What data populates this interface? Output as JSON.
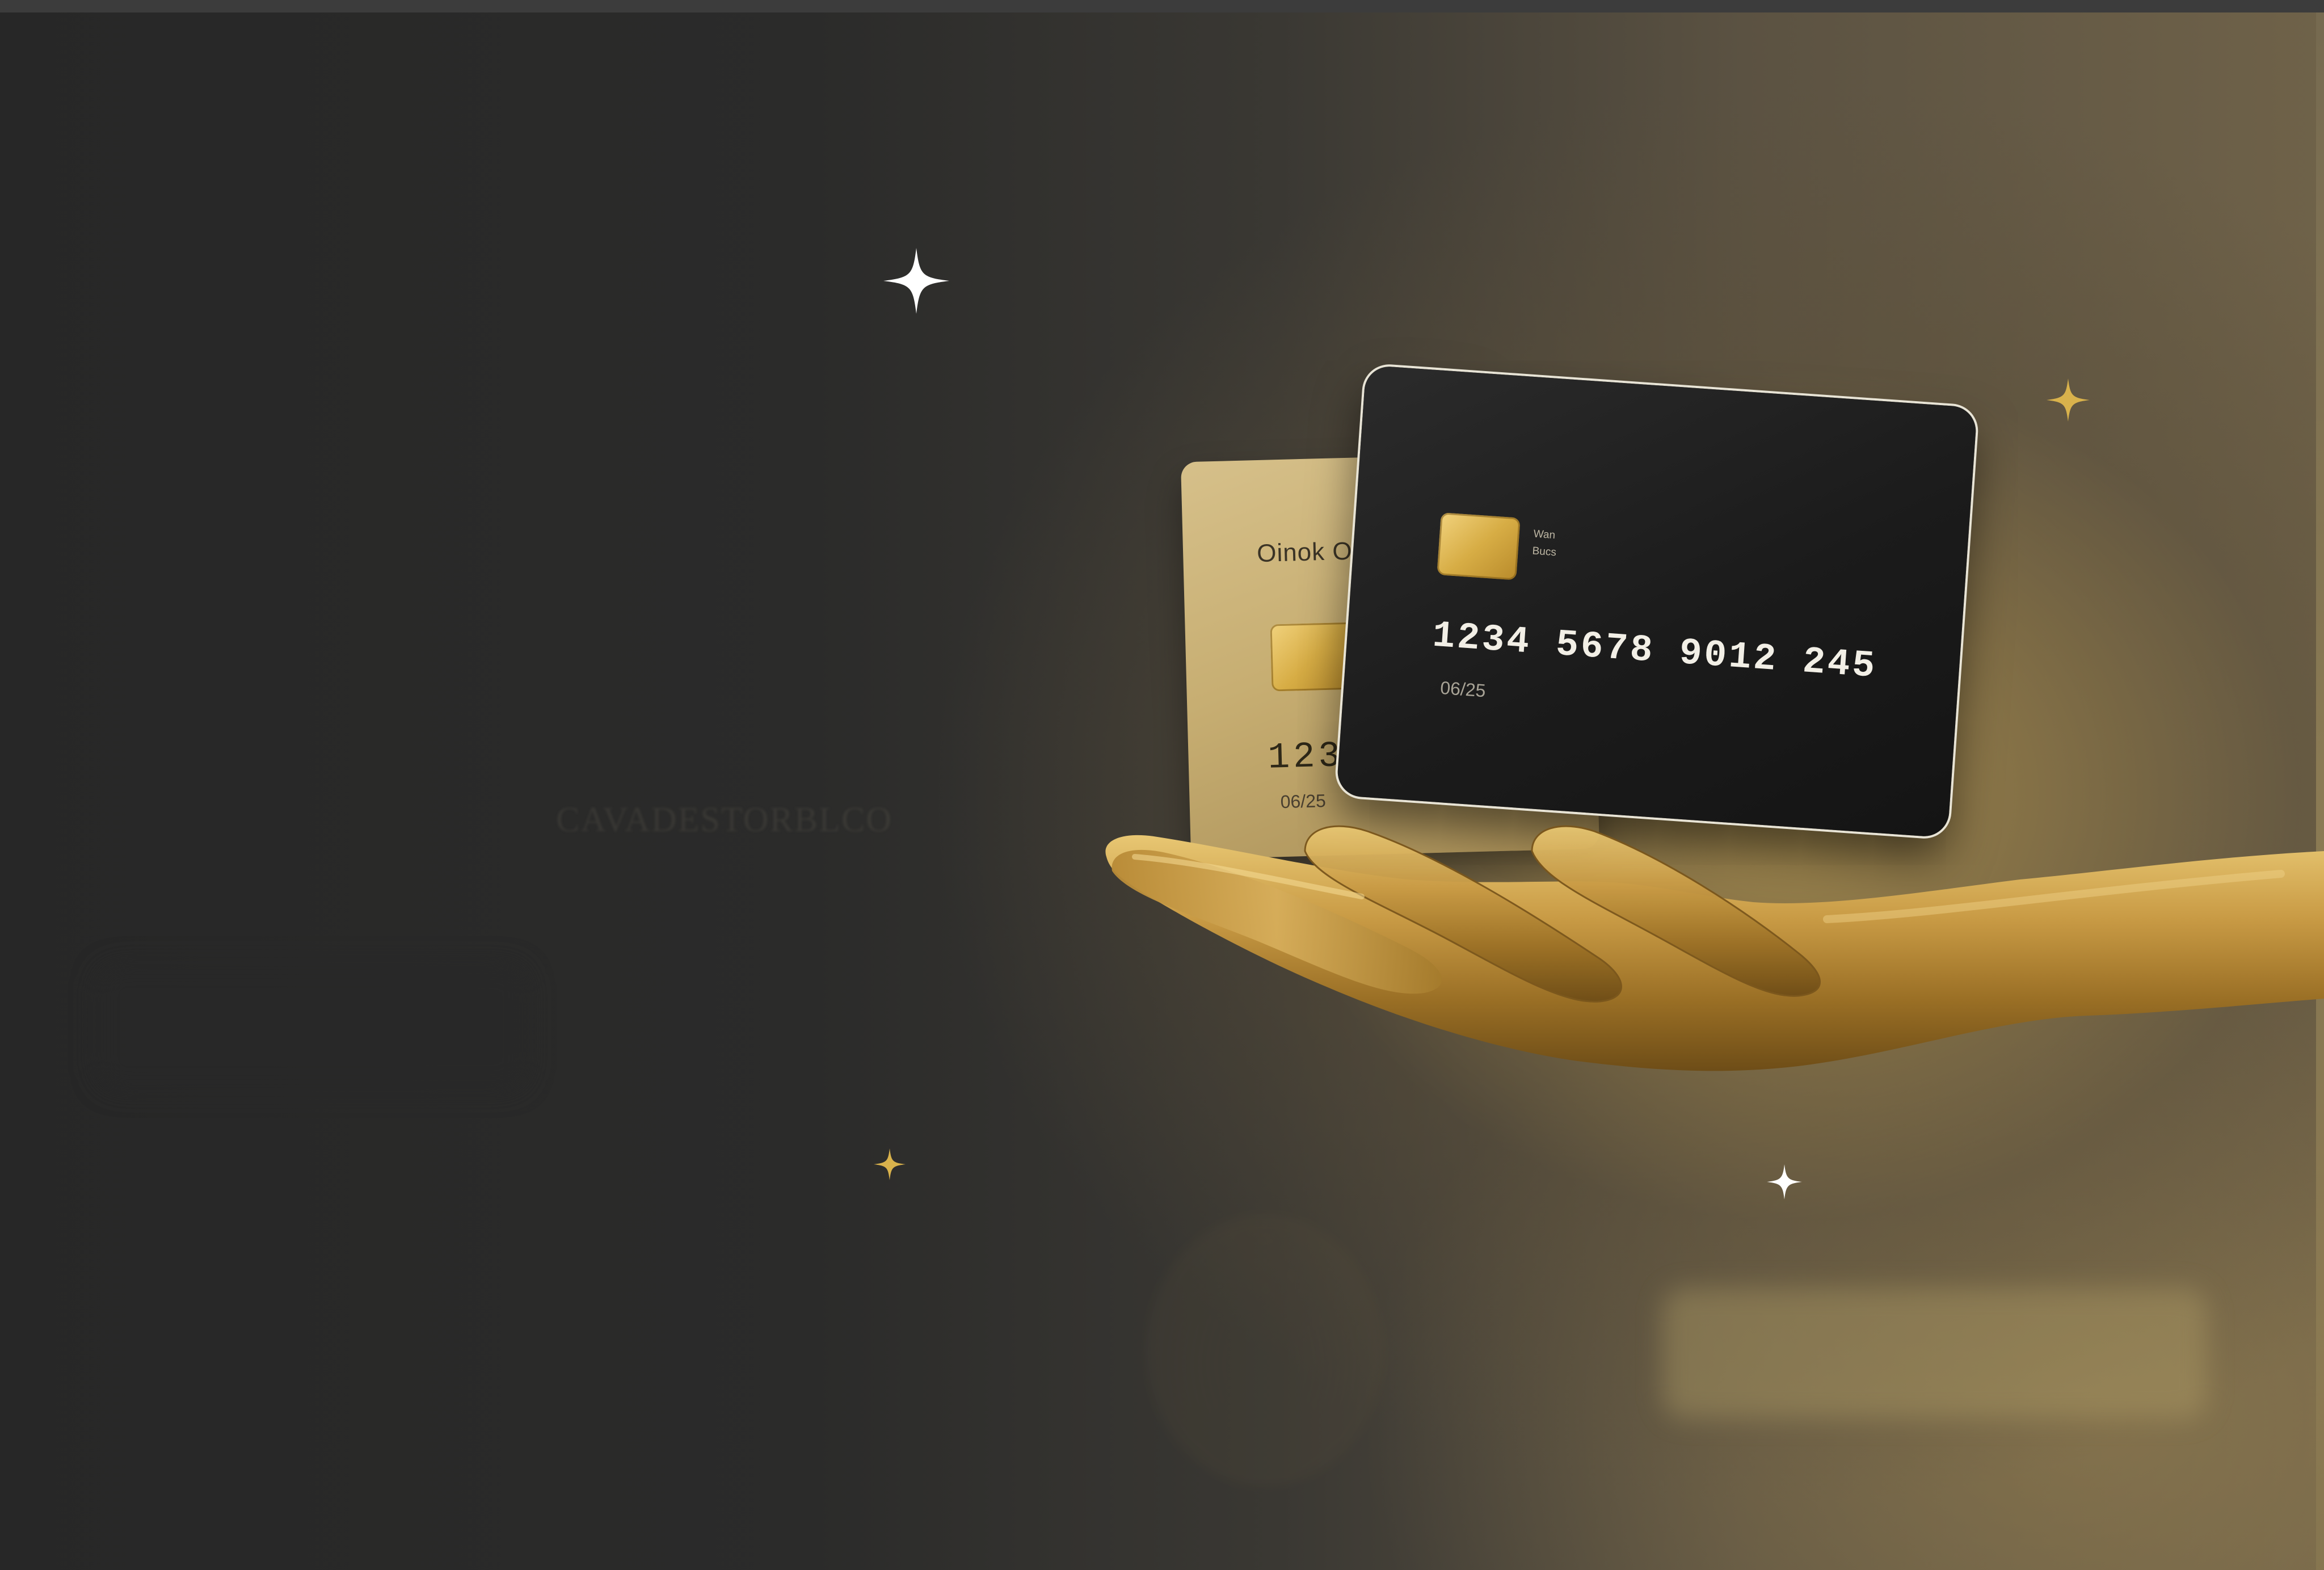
{
  "scene": {
    "palette": {
      "background_dark": "#2a2a29",
      "glow_gold": "#a48a4e",
      "gold_card": "#c7ae72",
      "black_card": "#1b1b1b",
      "hand_gold": "#b38b3c",
      "sparkle_white": "#ffffff",
      "sparkle_gold": "#d9b24c"
    },
    "ghost_text": "CAVADESTORBLCO",
    "gold_card": {
      "brand": "Oinok O",
      "number": "1234",
      "expiry": "06/25",
      "chip_icon": "chip-icon"
    },
    "black_card": {
      "label_line1": "Wan",
      "label_line2": "Bucs",
      "number": "1234  5678  9012  245",
      "expiry": "06/25",
      "chip_icon": "chip-icon"
    },
    "sparkles": [
      {
        "icon": "sparkle-icon",
        "color": "white"
      },
      {
        "icon": "sparkle-icon",
        "color": "gold"
      },
      {
        "icon": "sparkle-icon",
        "color": "gold"
      },
      {
        "icon": "sparkle-icon",
        "color": "white"
      }
    ]
  }
}
